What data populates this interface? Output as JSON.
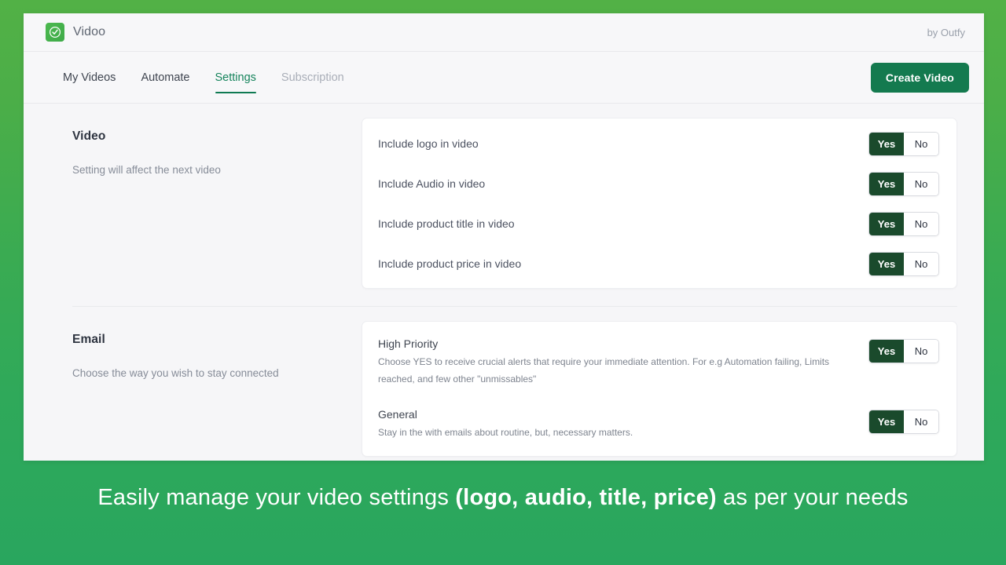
{
  "theme": {
    "background_gradient_top": "#52b146",
    "background_gradient_bottom": "#29a65e",
    "brand_green": "#4cb94f",
    "accent_dark_green": "#147a4f",
    "toggle_on_green": "#1a4a2c",
    "panel_background": "#f6f6f8"
  },
  "topbar": {
    "logo_icon": "check-circle-icon",
    "brand_name": "Vidoo",
    "byline": "by Outfy"
  },
  "nav": {
    "tabs": [
      {
        "label": "My Videos",
        "state": "default"
      },
      {
        "label": "Automate",
        "state": "default"
      },
      {
        "label": "Settings",
        "state": "active"
      },
      {
        "label": "Subscription",
        "state": "muted"
      }
    ],
    "primary_button": "Create Video"
  },
  "sections": [
    {
      "title": "Video",
      "description": "Setting will affect the next video",
      "rows": [
        {
          "label": "Include logo in video",
          "value": "Yes",
          "options": [
            "Yes",
            "No"
          ]
        },
        {
          "label": "Include Audio in video",
          "value": "Yes",
          "options": [
            "Yes",
            "No"
          ]
        },
        {
          "label": "Include product title in video",
          "value": "Yes",
          "options": [
            "Yes",
            "No"
          ]
        },
        {
          "label": "Include product price in video",
          "value": "Yes",
          "options": [
            "Yes",
            "No"
          ]
        }
      ]
    },
    {
      "title": "Email",
      "description": "Choose the way you wish to stay connected",
      "rows": [
        {
          "label": "High Priority",
          "sublabel": "Choose YES to receive crucial alerts that require your immediate attention. For e.g Automation failing, Limits reached, and few other \"unmissables\"",
          "value": "Yes",
          "options": [
            "Yes",
            "No"
          ]
        },
        {
          "label": "General",
          "sublabel": "Stay in the with emails about routine, but, necessary matters.",
          "value": "Yes",
          "options": [
            "Yes",
            "No"
          ]
        }
      ]
    }
  ],
  "caption": {
    "part1": "Easily manage your video settings ",
    "highlight": "(logo, audio, title, price)",
    "part2": " as per your needs"
  }
}
